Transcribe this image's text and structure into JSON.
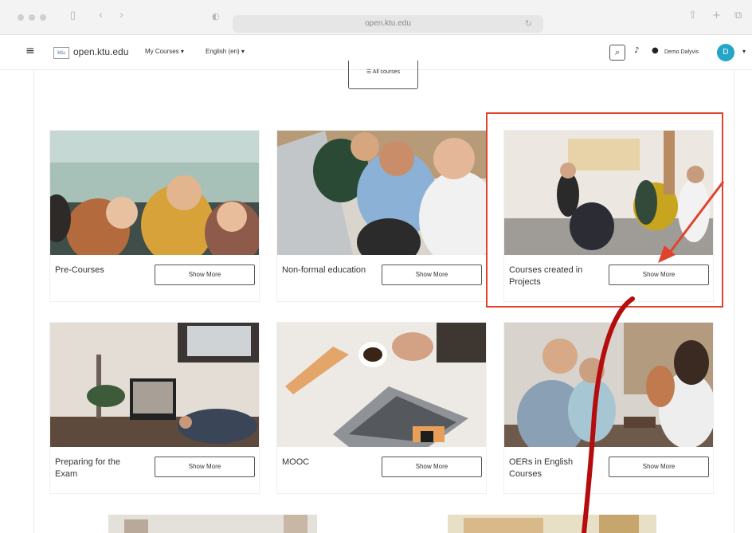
{
  "browser": {
    "url": "open.ktu.edu"
  },
  "navbar": {
    "logo_text": "ktu",
    "site_name": "open.ktu.edu",
    "menu": [
      {
        "label": "My Courses ▾"
      },
      {
        "label": "English (en) ▾"
      }
    ],
    "user_name": "Demo Dalyvis",
    "avatar_initial": "D"
  },
  "all_courses_label": "☰ All courses",
  "cards": [
    {
      "title": "Pre-Courses",
      "button": "Show More"
    },
    {
      "title": "Non-formal education",
      "button": "Show More"
    },
    {
      "title": "Courses created in Projects",
      "button": "Show More"
    },
    {
      "title": "Preparing for the Exam",
      "button": "Show More"
    },
    {
      "title": "MOOC",
      "button": "Show More"
    },
    {
      "title": "OERs in English Courses",
      "button": "Show More"
    }
  ],
  "annotation_colors": {
    "highlight_box": "#e0432d",
    "arrow": "#e0432d",
    "pen_stroke": "#b50d0d"
  },
  "icons": [
    "sidebar-icon",
    "back-icon",
    "forward-icon",
    "privacy-icon",
    "reload-icon",
    "share-icon",
    "new-tab-icon",
    "tabs-icon",
    "hamburger-icon",
    "search-icon",
    "bell-icon",
    "chat-icon"
  ]
}
